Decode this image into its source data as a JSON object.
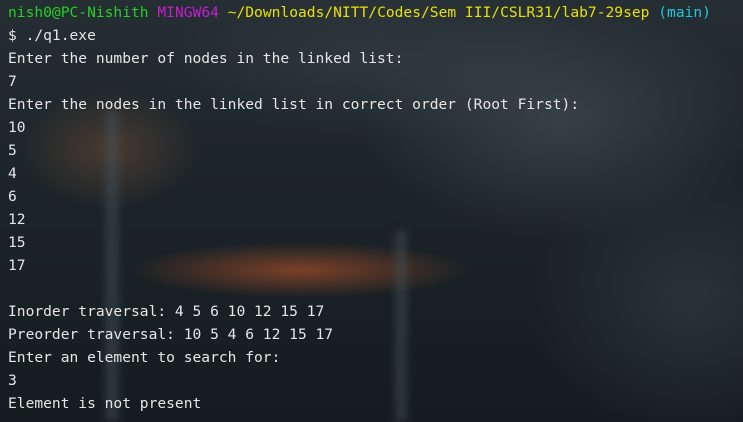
{
  "prompt": {
    "user_host": "nish0@PC-Nishith",
    "env": "MINGW64",
    "path": "~/Downloads/NITT/Codes/Sem III/CSLR31/lab7-29sep",
    "branch": "(main)",
    "command": "$ ./q1.exe"
  },
  "output_lines": [
    "Enter the number of nodes in the linked list:",
    "7",
    "Enter the nodes in the linked list in correct order (Root First):",
    "10",
    "5",
    "4",
    "6",
    "12",
    "15",
    "17",
    "",
    "Inorder traversal: 4 5 6 10 12 15 17",
    "Preorder traversal: 10 5 4 6 12 15 17",
    "Enter an element to search for:",
    "3",
    "Element is not present"
  ],
  "colors": {
    "user_host": "#23d023",
    "env": "#c020d0",
    "path": "#e8e000",
    "branch": "#20c8d8",
    "text": "#e6e6e6"
  }
}
